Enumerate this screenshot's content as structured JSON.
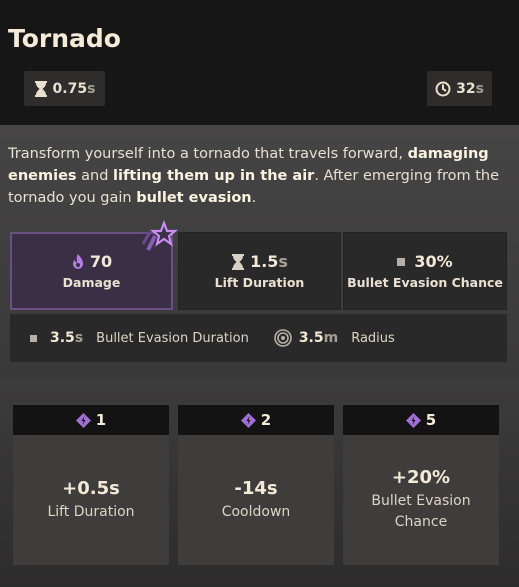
{
  "ability": {
    "title": "Tornado",
    "cast_time": "0.75",
    "cast_time_unit": "s",
    "cooldown": "32",
    "cooldown_unit": "s",
    "description": {
      "p1": "Transform yourself into a tornado that travels forward, ",
      "b1": "damaging enemies",
      "p2": " and ",
      "b2": "lifting them up in the air",
      "p3": ". After emerging from the tornado you gain ",
      "b3": "bullet evasion",
      "p4": "."
    }
  },
  "stats": [
    {
      "icon": "spirit-flame-icon",
      "value": "70",
      "unit": "",
      "label": "Damage"
    },
    {
      "icon": "hourglass-icon",
      "value": "1.5",
      "unit": "s",
      "label": "Lift Duration"
    },
    {
      "icon": "square-icon",
      "value": "30%",
      "unit": "",
      "label": "Bullet Evasion Chance"
    }
  ],
  "secondary_stats": [
    {
      "icon": "square-icon",
      "value": "3.5",
      "unit": "s",
      "label": "Bullet Evasion Duration"
    },
    {
      "icon": "radius-icon",
      "value": "3.5",
      "unit": "m",
      "label": "Radius"
    }
  ],
  "upgrades": [
    {
      "cost": "1",
      "bonus": "+0.5s",
      "label": "Lift Duration"
    },
    {
      "cost": "2",
      "bonus": "-14s",
      "label": "Cooldown"
    },
    {
      "cost": "5",
      "bonus": "+20%",
      "label": "Bullet Evasion Chance"
    }
  ],
  "colors": {
    "accent_purple": "#a06fd6",
    "header_bg": "#171616",
    "text": "#efe6d6"
  }
}
